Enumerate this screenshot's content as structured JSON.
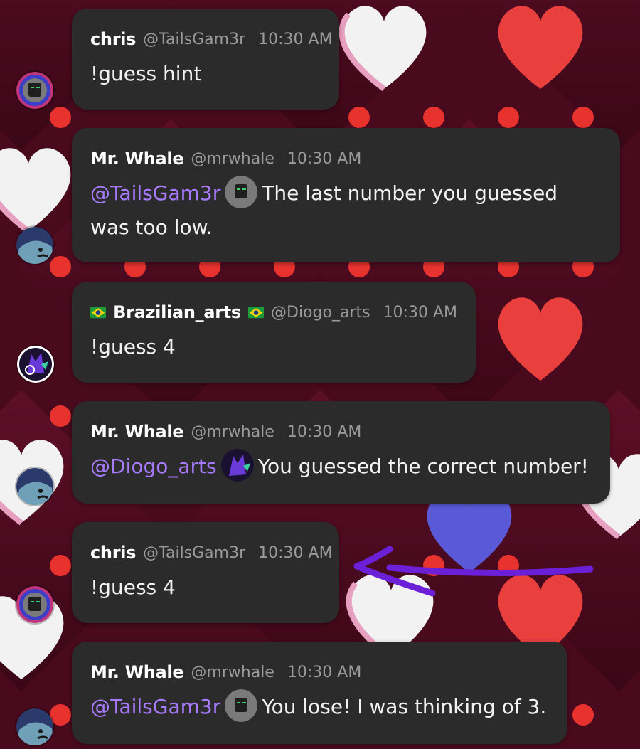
{
  "messages": [
    {
      "author": "chris",
      "handle": "@TailsGam3r",
      "time": "10:30 AM",
      "text": "!guess hint"
    },
    {
      "author": "Mr. Whale",
      "handle": "@mrwhale",
      "time": "10:30 AM",
      "mention": "@TailsGam3r",
      "text_line1": "The last number you guessed",
      "text_line2": "was too low."
    },
    {
      "author": "Brazilian_arts",
      "handle": "@Diogo_arts",
      "time": "10:30 AM",
      "text": "!guess 4"
    },
    {
      "author": "Mr. Whale",
      "handle": "@mrwhale",
      "time": "10:30 AM",
      "mention": "@Diogo_arts",
      "text": "You guessed the correct number!"
    },
    {
      "author": "chris",
      "handle": "@TailsGam3r",
      "time": "10:30 AM",
      "text": "!guess 4"
    },
    {
      "author": "Mr. Whale",
      "handle": "@mrwhale",
      "time": "10:30 AM",
      "mention": "@TailsGam3r",
      "text": "You lose! I was thinking of 3."
    }
  ],
  "colors": {
    "bubble": "#2b2b2b",
    "mention": "#a77bff",
    "meta": "#9a9a9a",
    "background": "#4a0a1e",
    "annotation_arrow": "#6b1fd6"
  },
  "icons": [
    "chris-avatar",
    "mrwhale-avatar",
    "brazilian-arts-avatar",
    "brazil-flag-icon",
    "annotation-arrow"
  ]
}
